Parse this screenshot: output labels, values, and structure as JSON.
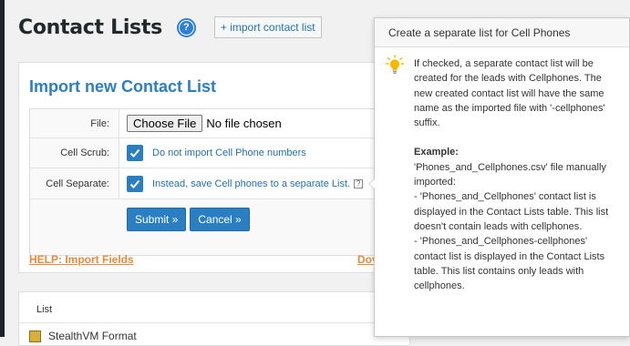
{
  "header": {
    "title": "Contact Lists",
    "help_icon_glyph": "?",
    "import_link": "+ import contact list"
  },
  "import_form": {
    "section_title": "Import new Contact List",
    "file": {
      "label": "File:",
      "button": "Choose File",
      "status": "No file chosen"
    },
    "cell_scrub": {
      "label": "Cell Scrub:",
      "text": "Do not import Cell Phone numbers",
      "checked": true
    },
    "cell_separate": {
      "label": "Cell Separate:",
      "text": "Instead, save Cell phones to a separate List.",
      "checked": true
    },
    "submit": "Submit »",
    "cancel": "Cancel »"
  },
  "links": {
    "help_import": "HELP: Import Fields",
    "truncated": "Dov"
  },
  "list_table": {
    "header": "List",
    "first_row": "StealthVM Format"
  },
  "tooltip": {
    "title": "Create a separate list for Cell Phones",
    "description": "If checked, a separate contact list will be created for the leads with Cellphones. The new created contact list will have the same name as the imported file with '-cellphones' suffix.",
    "example_label": "Example:",
    "example_lines": [
      "'Phones_and_Cellphones.csv' file manually imported:",
      "- 'Phones_and_Cellphones' contact list is displayed in the Contact Lists table. This list doesn't contain leads with cellphones.",
      "- 'Phones_and_Cellphones-cellphones' contact list is displayed in the Contact Lists table. This list contains only leads with cellphones."
    ]
  },
  "colors": {
    "accent": "#2a7fc2",
    "link_orange": "#e98a3a",
    "bulb": "#f6b800"
  }
}
